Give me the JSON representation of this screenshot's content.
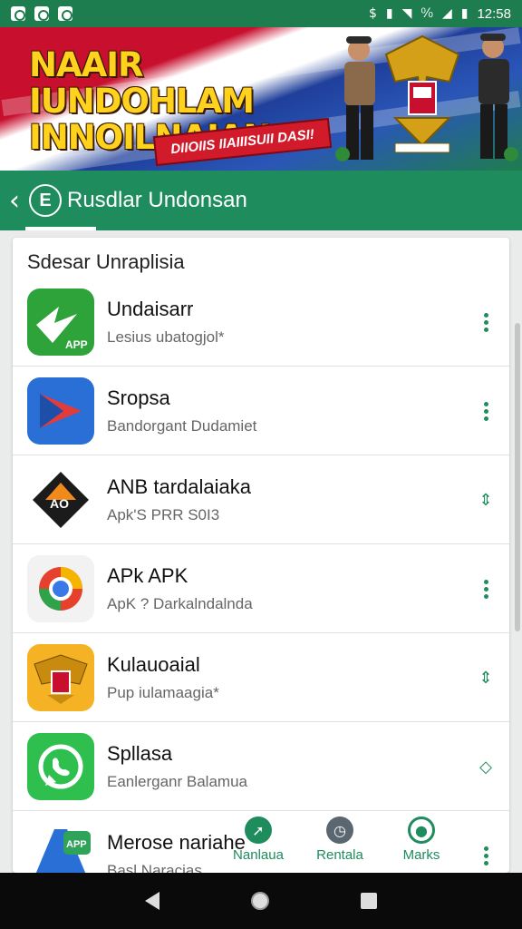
{
  "status_bar": {
    "left_icons": [
      "notification-icon",
      "notification-icon",
      "notification-icon"
    ],
    "right_text": "⁰⁄₀",
    "time": "12:58"
  },
  "banner": {
    "title_line1": "NAAIR IUNDOHLAM",
    "title_line2": "INNOILNAJAN",
    "ribbon": "DIIOIIS IIAIIISUII DASI!"
  },
  "appbar": {
    "logo_letter": "E",
    "title": "Rusdlar Undonsan"
  },
  "list": {
    "section_title": "Sdesar Unraplisia",
    "apps": [
      {
        "name": "Undaisarr",
        "sub": "Lesius ubatogjol*",
        "action": "menu",
        "icon": "star-badge-icon"
      },
      {
        "name": "Sropsa",
        "sub": "Bandorgant Dudamiet",
        "action": "menu",
        "icon": "play-triangle-icon"
      },
      {
        "name": "ANB tardalaiaka",
        "sub": "Apk'S PRR S0I3",
        "action": "install",
        "icon": "shield-logo-icon"
      },
      {
        "name": "APk APK",
        "sub": "ApK ? Darkalndalnda",
        "action": "menu",
        "icon": "browser-logo-icon"
      },
      {
        "name": "Kulauoaial",
        "sub": "Pup iulamaagia*",
        "action": "install",
        "icon": "garuda-icon"
      },
      {
        "name": "Spllasa",
        "sub": "Eanlerganr Balamua",
        "action": "install",
        "icon": "phone-chat-icon"
      },
      {
        "name": "Merose nariahe",
        "sub": "Basl Naracias",
        "action": "menu",
        "icon": "apk-store-icon"
      }
    ]
  },
  "bottom_tabs": [
    {
      "label": "Nanlaua",
      "icon": "explore-icon",
      "color": "#1e8c5c"
    },
    {
      "label": "Rentala",
      "icon": "clock-icon",
      "color": "#5a6670"
    },
    {
      "label": "Marks",
      "icon": "person-icon",
      "color": "#1e8c5c"
    }
  ],
  "colors": {
    "primary": "#1e8c5c",
    "status_bar": "#1e7d4e",
    "accent_red": "#c8102e"
  }
}
